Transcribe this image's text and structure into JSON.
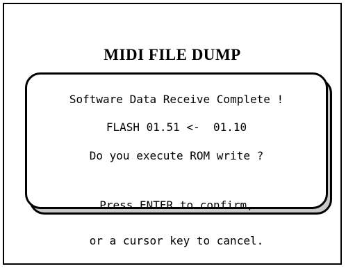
{
  "screen": {
    "title": "MIDI FILE DUMP"
  },
  "dialog": {
    "message": "Software Data Receive Complete !",
    "version_line": "FLASH 01.51 <-  01.10",
    "question": "Do you execute ROM write ?",
    "instruction_line1": "Press ENTER to confirm,",
    "instruction_line2": "or a cursor key to cancel."
  }
}
